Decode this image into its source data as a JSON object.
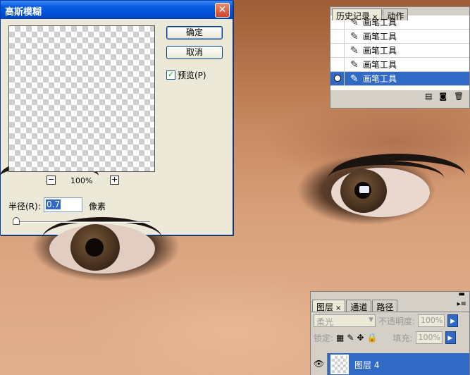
{
  "dialog": {
    "title": "高斯模糊",
    "close_glyph": "✕",
    "ok_label": "确定",
    "cancel_label": "取消",
    "preview_label": "预览(P)",
    "preview_checked": true,
    "zoom_out_glyph": "−",
    "zoom_in_glyph": "+",
    "zoom_level": "100%",
    "radius_label": "半径(R):",
    "radius_value": "0.7",
    "radius_unit": "像素"
  },
  "history": {
    "tabs": [
      {
        "label": "历史记录",
        "close": "×"
      },
      {
        "label": "动作"
      }
    ],
    "items": [
      {
        "label": "画笔工具"
      },
      {
        "label": "画笔工具"
      },
      {
        "label": "画笔工具"
      },
      {
        "label": "画笔工具"
      },
      {
        "label": "画笔工具",
        "selected": true
      }
    ],
    "footer_icons": [
      "new-document-icon",
      "camera-icon",
      "trash-icon"
    ]
  },
  "layers": {
    "menu_glyph": "▸≡",
    "tabs": [
      {
        "label": "图层",
        "close": "×"
      },
      {
        "label": "通道"
      },
      {
        "label": "路径"
      }
    ],
    "blend_mode": "柔光",
    "opacity_label": "不透明度:",
    "opacity_value": "100%",
    "lock_label": "锁定:",
    "fill_label": "填充:",
    "fill_value": "100%",
    "layer_name": "图层 4"
  },
  "colors": {
    "selection": "#316ac5",
    "titlebar": "#0050d8",
    "dialog_bg": "#ece9d8"
  }
}
